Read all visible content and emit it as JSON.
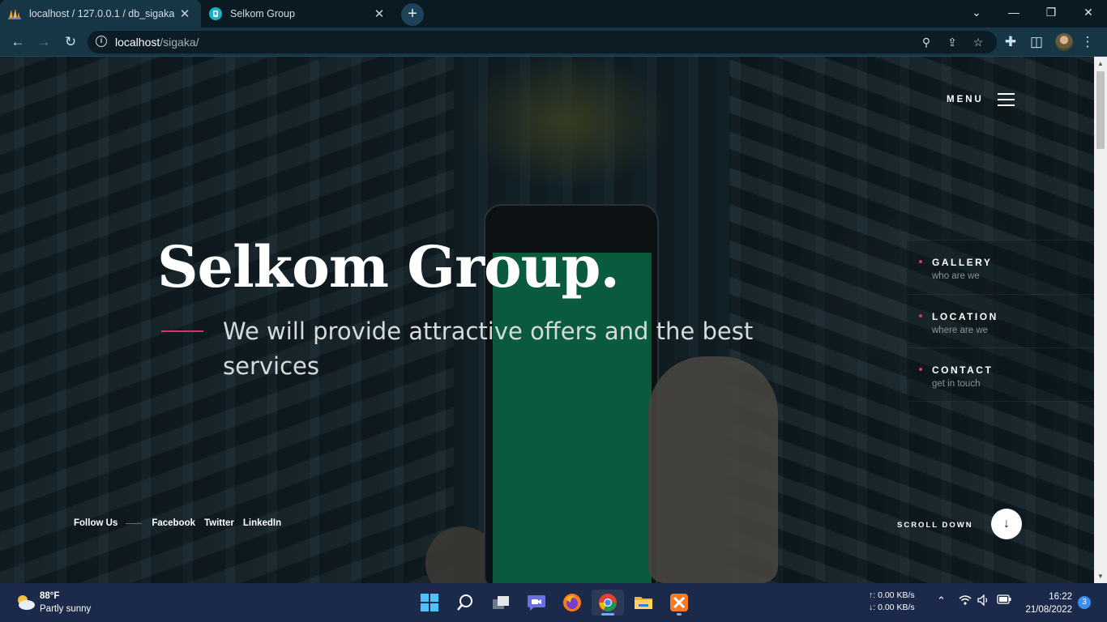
{
  "browser": {
    "tabs": [
      {
        "title": "localhost / 127.0.0.1 / db_sigaka |",
        "close": "✕"
      },
      {
        "title": "Selkom Group",
        "close": "✕"
      }
    ],
    "new_tab": "+",
    "window_controls": {
      "dropdown": "⌄",
      "minimize": "—",
      "restore": "❐",
      "close": "✕"
    },
    "url_host": "localhost",
    "url_path": "/sigaka/"
  },
  "site": {
    "menu_label": "MENU",
    "title": "Selkom Group.",
    "subtitle": "We will provide attractive offers and the best services",
    "side_nav": [
      {
        "title": "GALLERY",
        "subtitle": "who are we"
      },
      {
        "title": "LOCATION",
        "subtitle": "where are we"
      },
      {
        "title": "CONTACT",
        "subtitle": "get in touch"
      }
    ],
    "follow_label": "Follow Us",
    "social": [
      "Facebook",
      "Twitter",
      "LinkedIn"
    ],
    "scroll_label": "SCROLL DOWN",
    "accent_color": "#d6336c"
  },
  "taskbar": {
    "weather_temp": "88°F",
    "weather_desc": "Partly sunny",
    "net_up": "↑: 0.00 KB/s",
    "net_down": "↓: 0.00 KB/s",
    "time": "16:22",
    "date": "21/08/2022",
    "notifications": "3",
    "apps": [
      "windows-start-icon",
      "search-icon",
      "task-view-icon",
      "teams-chat-icon",
      "firefox-icon",
      "chrome-icon",
      "file-explorer-icon",
      "xampp-icon"
    ]
  }
}
